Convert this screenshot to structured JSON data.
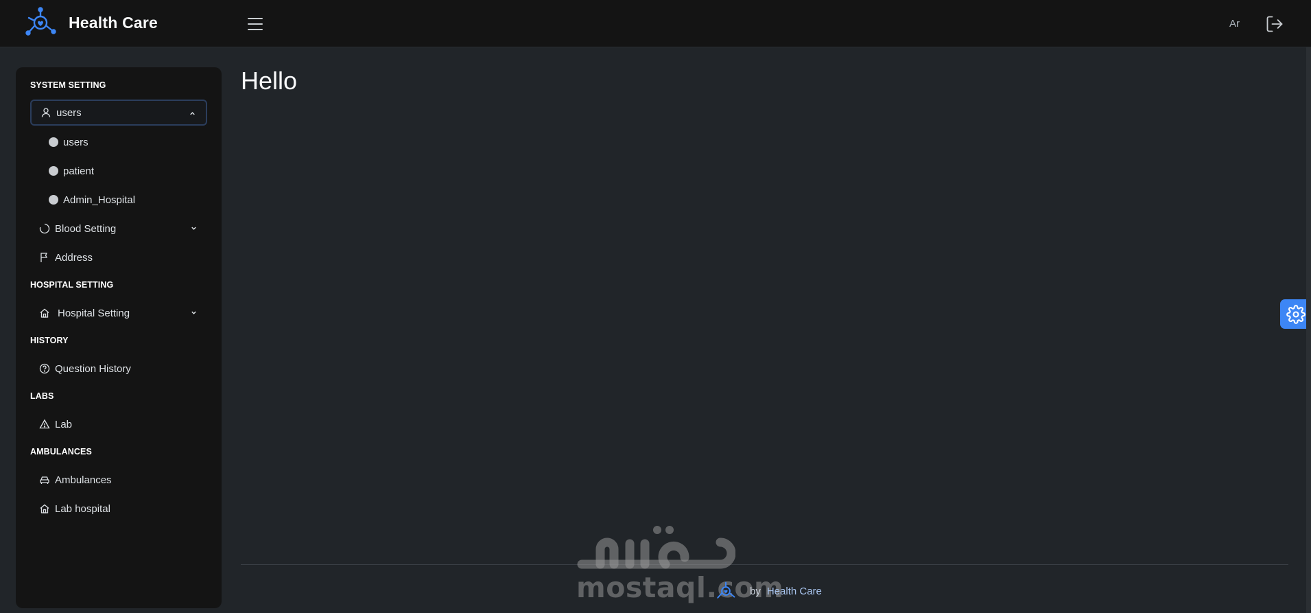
{
  "header": {
    "brand_title": "Health Care",
    "menu_icon": "hamburger-menu-icon",
    "lang_label": "Ar",
    "logout_icon": "logout-icon",
    "accent_color": "#3d86f5"
  },
  "sidebar": {
    "sections": [
      {
        "title": "SYSTEM SETTING",
        "items": [
          {
            "label": "users",
            "icon": "user-icon",
            "expanded": true,
            "children": [
              "users",
              "patient",
              "Admin_Hospital"
            ]
          },
          {
            "label": "Blood Setting",
            "icon": "loader-circle-icon",
            "expandable": true
          },
          {
            "label": "Address",
            "icon": "flag-icon"
          }
        ]
      },
      {
        "title": "HOSPITAL SETTING",
        "items": [
          {
            "label": "Hospital Setting",
            "icon": "home-icon",
            "expandable": true
          }
        ]
      },
      {
        "title": "HISTORY",
        "items": [
          {
            "label": "Question History",
            "icon": "question-circle-icon"
          }
        ]
      },
      {
        "title": "LABS",
        "items": [
          {
            "label": "Lab",
            "icon": "warning-triangle-icon"
          }
        ]
      },
      {
        "title": "AMBULANCES",
        "items": [
          {
            "label": "Ambulances",
            "icon": "car-icon"
          },
          {
            "label": "Lab hospital",
            "icon": "home-icon"
          }
        ]
      }
    ]
  },
  "main": {
    "title": "Hello"
  },
  "footer": {
    "by_label": "by",
    "brand_label": "Health Care"
  },
  "watermark": {
    "arabic_text": "مستقل",
    "latin_text": "mostaql.com"
  },
  "settings_button": {
    "icon": "gear-icon",
    "color": "#3d86f5"
  }
}
